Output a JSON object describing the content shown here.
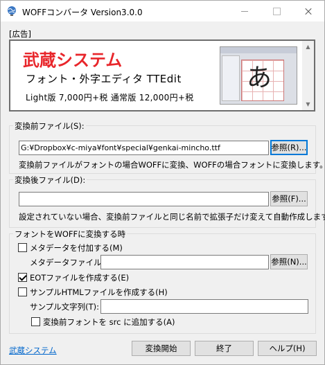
{
  "window": {
    "title": "WOFFコンバータ Version3.0.0"
  },
  "ad": {
    "label": "[広告]",
    "title": "武蔵システム",
    "subtitle": "フォント・外字エディタ TTEdit",
    "price": "Light版 7,000円+税 通常版 12,000円+税",
    "sample_glyph": "あ"
  },
  "source": {
    "label": "変換前ファイル(S):",
    "value": "G:¥Dropbox¥c-miya¥font¥special¥genkai-mincho.ttf",
    "browse": "参照(R)...",
    "note": "変換前ファイルがフォントの場合WOFFに変換、WOFFの場合フォントに変換します。"
  },
  "dest": {
    "label": "変換後ファイル(D):",
    "value": "",
    "browse": "参照(F)...",
    "note": "設定されていない場合、変換前ファイルと同じ名前で拡張子だけ変えて自動作成します。"
  },
  "options": {
    "label": "フォントをWOFFに変換する時",
    "metadata_check": "メタデータを付加する(M)",
    "metadata_file_label": "メタデータファイル(I):",
    "metadata_file_value": "",
    "metadata_browse": "参照(N)...",
    "eot_check": "EOTファイルを作成する(E)",
    "eot_checked": true,
    "html_check": "サンプルHTMLファイルを作成する(H)",
    "sample_text_label": "サンプル文字列(T):",
    "sample_text_value": "",
    "src_check": "変換前フォントを src に追加する(A)"
  },
  "footer": {
    "link": "武蔵システム",
    "start": "変換開始",
    "exit": "終了",
    "help": "ヘルプ(H)"
  }
}
